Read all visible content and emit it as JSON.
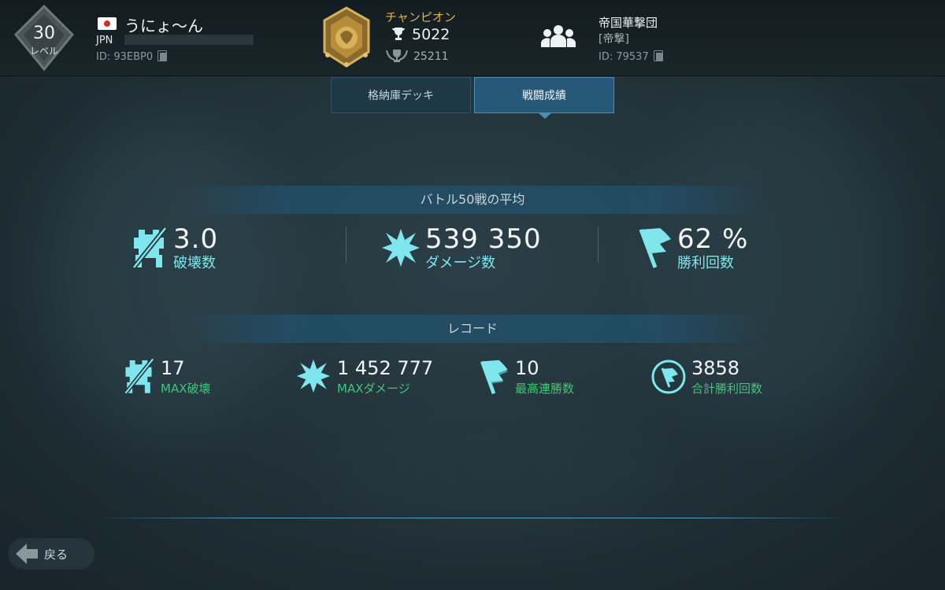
{
  "player": {
    "level": "30",
    "level_label": "レベル",
    "name": "うにょ〜ん",
    "country": "JPN",
    "id_text": "ID: 93EBP0"
  },
  "league": {
    "rank": "チャンピオン",
    "trophies": "5022",
    "max_trophies": "25211"
  },
  "clan": {
    "name": "帝国華撃団",
    "tag": "[帝撃]",
    "id_text": "ID: 79537"
  },
  "tabs": [
    {
      "label": "格納庫デッキ",
      "active": false
    },
    {
      "label": "戦闘成績",
      "active": true
    }
  ],
  "average": {
    "title": "バトル50戦の平均",
    "kills": {
      "value": "3.0",
      "label": "破壊数"
    },
    "damage": {
      "value": "539 350",
      "label": "ダメージ数"
    },
    "winrate": {
      "value": "62 %",
      "label": "勝利回数"
    }
  },
  "records": {
    "title": "レコード",
    "max_kills": {
      "value": "17",
      "label": "MAX破壊"
    },
    "max_damage": {
      "value": "1 452 777",
      "label": "MAXダメージ"
    },
    "win_streak": {
      "value": "10",
      "label": "最高連勝数"
    },
    "total_wins": {
      "value": "3858",
      "label": "合計勝利回数"
    }
  },
  "back_label": "戻る",
  "colors": {
    "accent_cyan": "#7ee6ec",
    "record_green": "#44c478",
    "gold": "#e2b54b",
    "tab_active": "#27587a"
  },
  "icons": [
    "level-badge-icon",
    "flag-jp-icon",
    "copy-icon",
    "league-emblem-icon",
    "trophy-icon",
    "max-trophy-icon",
    "clan-members-icon",
    "robot-destroyed-icon",
    "explosion-icon",
    "victory-flag-icon",
    "win-streak-flag-icon",
    "total-wins-flag-icon",
    "back-arrow-icon"
  ]
}
